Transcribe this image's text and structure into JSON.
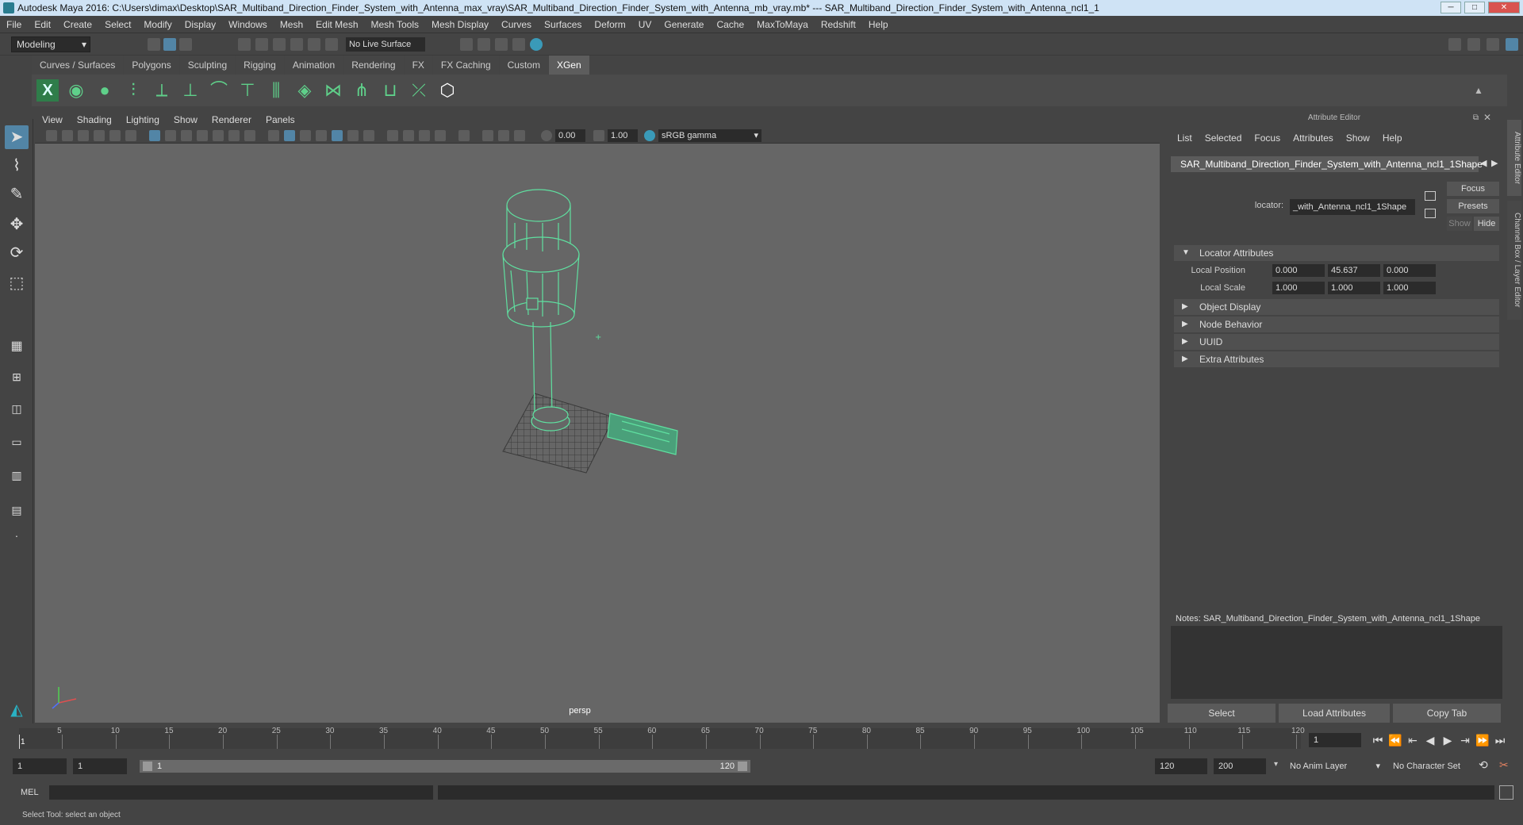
{
  "window": {
    "title": "Autodesk Maya 2016: C:\\Users\\dimax\\Desktop\\SAR_Multiband_Direction_Finder_System_with_Antenna_max_vray\\SAR_Multiband_Direction_Finder_System_with_Antenna_mb_vray.mb*  ---  SAR_Multiband_Direction_Finder_System_with_Antenna_ncl1_1"
  },
  "menubar": [
    "File",
    "Edit",
    "Create",
    "Select",
    "Modify",
    "Display",
    "Windows",
    "Mesh",
    "Edit Mesh",
    "Mesh Tools",
    "Mesh Display",
    "Curves",
    "Surfaces",
    "Deform",
    "UV",
    "Generate",
    "Cache",
    "MaxToMaya",
    "Redshift",
    "Help"
  ],
  "toolbar": {
    "mode": "Modeling",
    "live_surface": "No Live Surface"
  },
  "shelf_tabs": [
    "Curves / Surfaces",
    "Polygons",
    "Sculpting",
    "Rigging",
    "Animation",
    "Rendering",
    "FX",
    "FX Caching",
    "Custom",
    "XGen"
  ],
  "shelf_active": "XGen",
  "viewport": {
    "menu": [
      "View",
      "Shading",
      "Lighting",
      "Show",
      "Renderer",
      "Panels"
    ],
    "exposure": "0.00",
    "gamma": "1.00",
    "colorspace": "sRGB gamma",
    "camera_label": "persp"
  },
  "attribute_editor": {
    "title": "Attribute Editor",
    "menu": [
      "List",
      "Selected",
      "Focus",
      "Attributes",
      "Show",
      "Help"
    ],
    "node_tab": "SAR_Multiband_Direction_Finder_System_with_Antenna_ncl1_1Shape",
    "focus_btn": "Focus",
    "presets_btn": "Presets",
    "show_btn": "Show",
    "hide_btn": "Hide",
    "locator_label": "locator:",
    "locator_value": "_with_Antenna_ncl1_1Shape",
    "sections": {
      "locator_attributes": "Locator Attributes",
      "object_display": "Object Display",
      "node_behavior": "Node Behavior",
      "uuid": "UUID",
      "extra_attributes": "Extra Attributes"
    },
    "local_position": {
      "label": "Local Position",
      "x": "0.000",
      "y": "45.637",
      "z": "0.000"
    },
    "local_scale": {
      "label": "Local Scale",
      "x": "1.000",
      "y": "1.000",
      "z": "1.000"
    },
    "notes": "Notes:  SAR_Multiband_Direction_Finder_System_with_Antenna_ncl1_1Shape",
    "buttons": {
      "select": "Select",
      "load": "Load Attributes",
      "copy": "Copy Tab"
    }
  },
  "side_tabs": [
    "Attribute Editor",
    "Channel Box / Layer Editor"
  ],
  "timeline": {
    "ticks": [
      "5",
      "10",
      "15",
      "20",
      "25",
      "30",
      "35",
      "40",
      "45",
      "50",
      "55",
      "60",
      "65",
      "70",
      "75",
      "80",
      "85",
      "90",
      "95",
      "100",
      "105",
      "110",
      "115",
      "120"
    ],
    "start_label": "1",
    "current_frame": "1"
  },
  "range": {
    "start": "1",
    "start2": "1",
    "slider_start": "1",
    "slider_end": "120",
    "end": "120",
    "end2": "200",
    "anim_layer": "No Anim Layer",
    "char_set": "No Character Set"
  },
  "command": {
    "label": "MEL"
  },
  "status": "Select Tool: select an object",
  "colors": {
    "wire": "#5fe0a0",
    "accent": "#5285a6"
  }
}
